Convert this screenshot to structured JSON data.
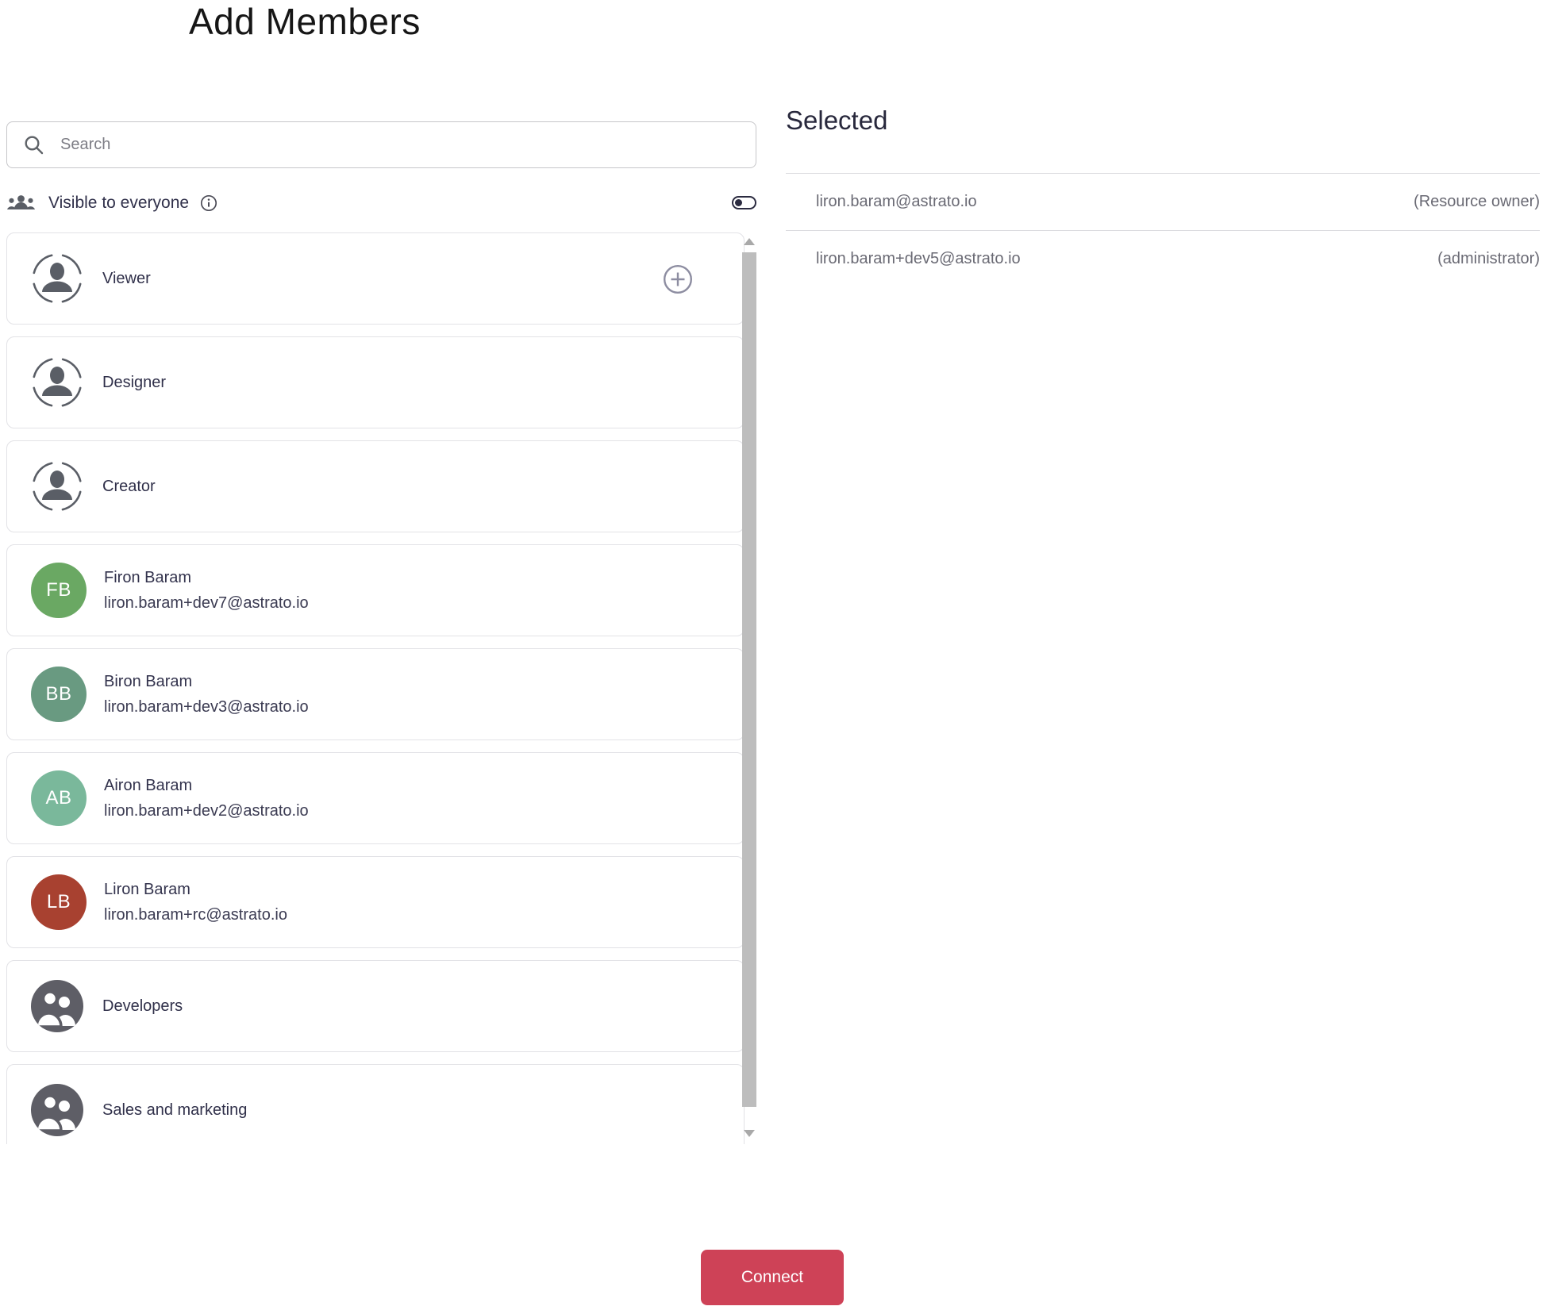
{
  "title": "Add Members",
  "search": {
    "placeholder": "Search"
  },
  "visibility": {
    "label": "Visible to everyone",
    "toggle_state": "off"
  },
  "list": {
    "roles": [
      {
        "label": "Viewer",
        "has_add_button": true
      },
      {
        "label": "Designer",
        "has_add_button": false
      },
      {
        "label": "Creator",
        "has_add_button": false
      }
    ],
    "users": [
      {
        "initials": "FB",
        "name": "Firon Baram",
        "email": "liron.baram+dev7@astrato.io",
        "avatar_color": "#6aa863"
      },
      {
        "initials": "BB",
        "name": "Biron Baram",
        "email": "liron.baram+dev3@astrato.io",
        "avatar_color": "#699a81"
      },
      {
        "initials": "AB",
        "name": "Airon Baram",
        "email": "liron.baram+dev2@astrato.io",
        "avatar_color": "#7ab89b"
      },
      {
        "initials": "LB",
        "name": "Liron Baram",
        "email": "liron.baram+rc@astrato.io",
        "avatar_color": "#a84130"
      }
    ],
    "groups": [
      {
        "label": "Developers"
      },
      {
        "label": "Sales and marketing"
      }
    ]
  },
  "selected": {
    "heading": "Selected",
    "items": [
      {
        "email": "liron.baram@astrato.io",
        "role": "(Resource owner)"
      },
      {
        "email": "liron.baram+dev5@astrato.io",
        "role": "(administrator)"
      }
    ]
  },
  "footer": {
    "connect_label": "Connect"
  },
  "colors": {
    "accent": "#ce4257",
    "toggle": "#2b2b40",
    "icon_gray": "#5a5e66",
    "group_circle": "#5e5e66",
    "scroll_thumb": "#bdbdbd"
  },
  "icons": {
    "search": "magnifier-icon",
    "visibility": "people-group-icon",
    "info": "info-circle-icon",
    "role_avatar": "person-dashed-circle-icon",
    "group_avatar": "people-filled-circle-icon",
    "add": "plus-circle-icon",
    "toggle": "switch-off",
    "scroll_up": "triangle-up-icon",
    "scroll_down": "triangle-down-icon"
  }
}
